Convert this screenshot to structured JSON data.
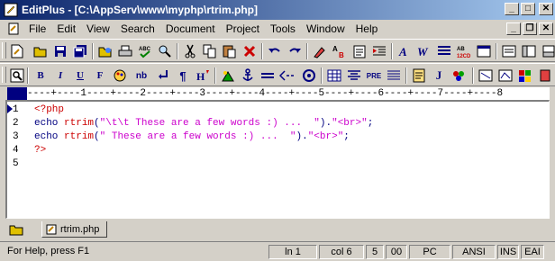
{
  "window": {
    "title": "EditPlus - [C:\\AppServ\\www\\myphp\\rtrim.php]"
  },
  "menu": {
    "items": [
      "File",
      "Edit",
      "View",
      "Search",
      "Document",
      "Project",
      "Tools",
      "Window",
      "Help"
    ]
  },
  "toolbar2": {
    "labels": [
      "B",
      "I",
      "U",
      "F",
      "nb",
      "PRE",
      "J"
    ]
  },
  "ruler": {
    "text": "----+----1----+----2----+----3----+----4----+----5----+----6----+----7----+----8"
  },
  "editor": {
    "line_numbers": [
      "1",
      "2",
      "3",
      "4",
      "5"
    ],
    "lines": [
      {
        "parts": [
          {
            "t": "<?php",
            "c": "tag"
          }
        ]
      },
      {
        "parts": [
          {
            "t": "echo ",
            "c": "kw"
          },
          {
            "t": "rtrim",
            "c": "fn"
          },
          {
            "t": "(",
            "c": "kw"
          },
          {
            "t": "\"\\t\\t These are a few words :) ...  \"",
            "c": "str"
          },
          {
            "t": ").",
            "c": "kw"
          },
          {
            "t": "\"<br>\"",
            "c": "str"
          },
          {
            "t": ";",
            "c": "kw"
          }
        ]
      },
      {
        "parts": [
          {
            "t": "echo ",
            "c": "kw"
          },
          {
            "t": "rtrim",
            "c": "fn"
          },
          {
            "t": "(",
            "c": "kw"
          },
          {
            "t": "\" These are a few words :) ...  \"",
            "c": "str"
          },
          {
            "t": ").",
            "c": "kw"
          },
          {
            "t": "\"<br>\"",
            "c": "str"
          },
          {
            "t": ";",
            "c": "kw"
          }
        ]
      },
      {
        "parts": [
          {
            "t": "?>",
            "c": "tag"
          }
        ]
      },
      {
        "parts": []
      }
    ]
  },
  "tabs": {
    "active": "rtrim.php"
  },
  "status": {
    "help": "For Help, press F1",
    "ln": "ln 1",
    "col": "col 6",
    "count": "5",
    "hex": "00",
    "pc": "PC",
    "enc": "ANSI",
    "ins": "INS",
    "extra": "EAI"
  },
  "colors": {
    "title_start": "#0a246a",
    "title_end": "#a6caf0",
    "keyword": "#000080",
    "function": "#cc0000",
    "string": "#cc00cc"
  }
}
